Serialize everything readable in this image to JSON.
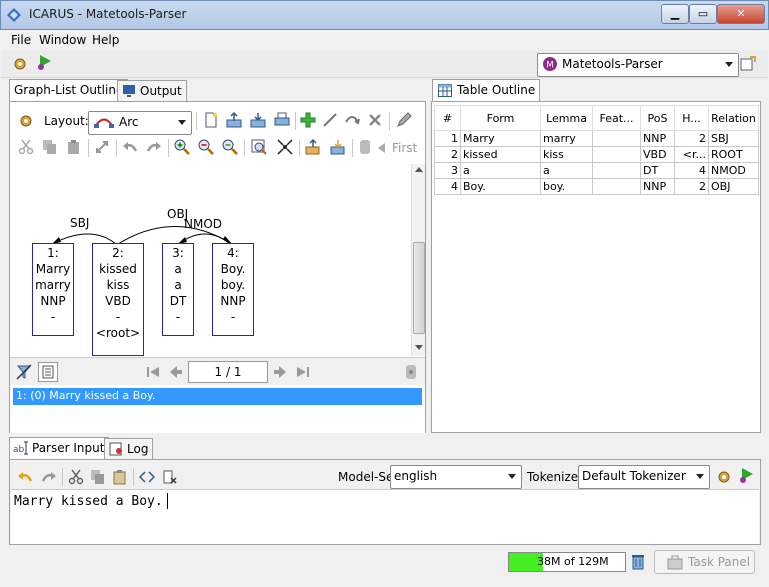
{
  "window": {
    "title": "ICARUS - Matetools-Parser"
  },
  "menu": {
    "items": [
      "File",
      "Window",
      "Help"
    ]
  },
  "perspective": {
    "selected": "Matetools-Parser",
    "badge": "M"
  },
  "left_panel": {
    "tabs": [
      "Graph-List Outline",
      "Output"
    ],
    "layout_label": "Layout:",
    "layout_value": "Arc",
    "first_label": "First",
    "arcs": [
      {
        "label": "SBJ"
      },
      {
        "label": "OBJ"
      },
      {
        "label": "NMOD"
      }
    ],
    "nodes": [
      {
        "lines": [
          "1:",
          "Marry",
          "marry",
          "NNP",
          "-"
        ]
      },
      {
        "lines": [
          "2:",
          "kissed",
          "kiss",
          "VBD",
          "-",
          "<root>"
        ]
      },
      {
        "lines": [
          "3:",
          "a",
          "a",
          "DT",
          "-"
        ]
      },
      {
        "lines": [
          "4:",
          "Boy.",
          "boy.",
          "NNP",
          "-"
        ]
      }
    ],
    "pager": {
      "value": "1 / 1"
    },
    "list": [
      "1: (0) Marry kissed a Boy."
    ]
  },
  "right_panel": {
    "tab": "Table Outline",
    "columns": [
      "#",
      "Form",
      "Lemma",
      "Feat...",
      "PoS",
      "H...",
      "Relation"
    ],
    "rows": [
      [
        "1",
        "Marry",
        "marry",
        "",
        "NNP",
        "2",
        "SBJ"
      ],
      [
        "2",
        "kissed",
        "kiss",
        "",
        "VBD",
        "<r...",
        "ROOT"
      ],
      [
        "3",
        "a",
        "a",
        "",
        "DT",
        "4",
        "NMOD"
      ],
      [
        "4",
        "Boy.",
        "boy.",
        "",
        "NNP",
        "2",
        "OBJ"
      ]
    ]
  },
  "bottom_panel": {
    "tabs": [
      "Parser Input",
      "Log"
    ],
    "model_set_label": "Model-Set",
    "model_set_value": "english",
    "tokenizer_label": "Tokenizer",
    "tokenizer_value": "Default Tokenizer",
    "input_text": "Marry kissed a Boy."
  },
  "status": {
    "memory_text": "38M of 129M",
    "memory_fraction": 0.29,
    "task_panel_label": "Task Panel"
  },
  "colors": {
    "selection": "#3399ff",
    "node_border": "#2727a8",
    "memory_fill": "#44ee22"
  }
}
